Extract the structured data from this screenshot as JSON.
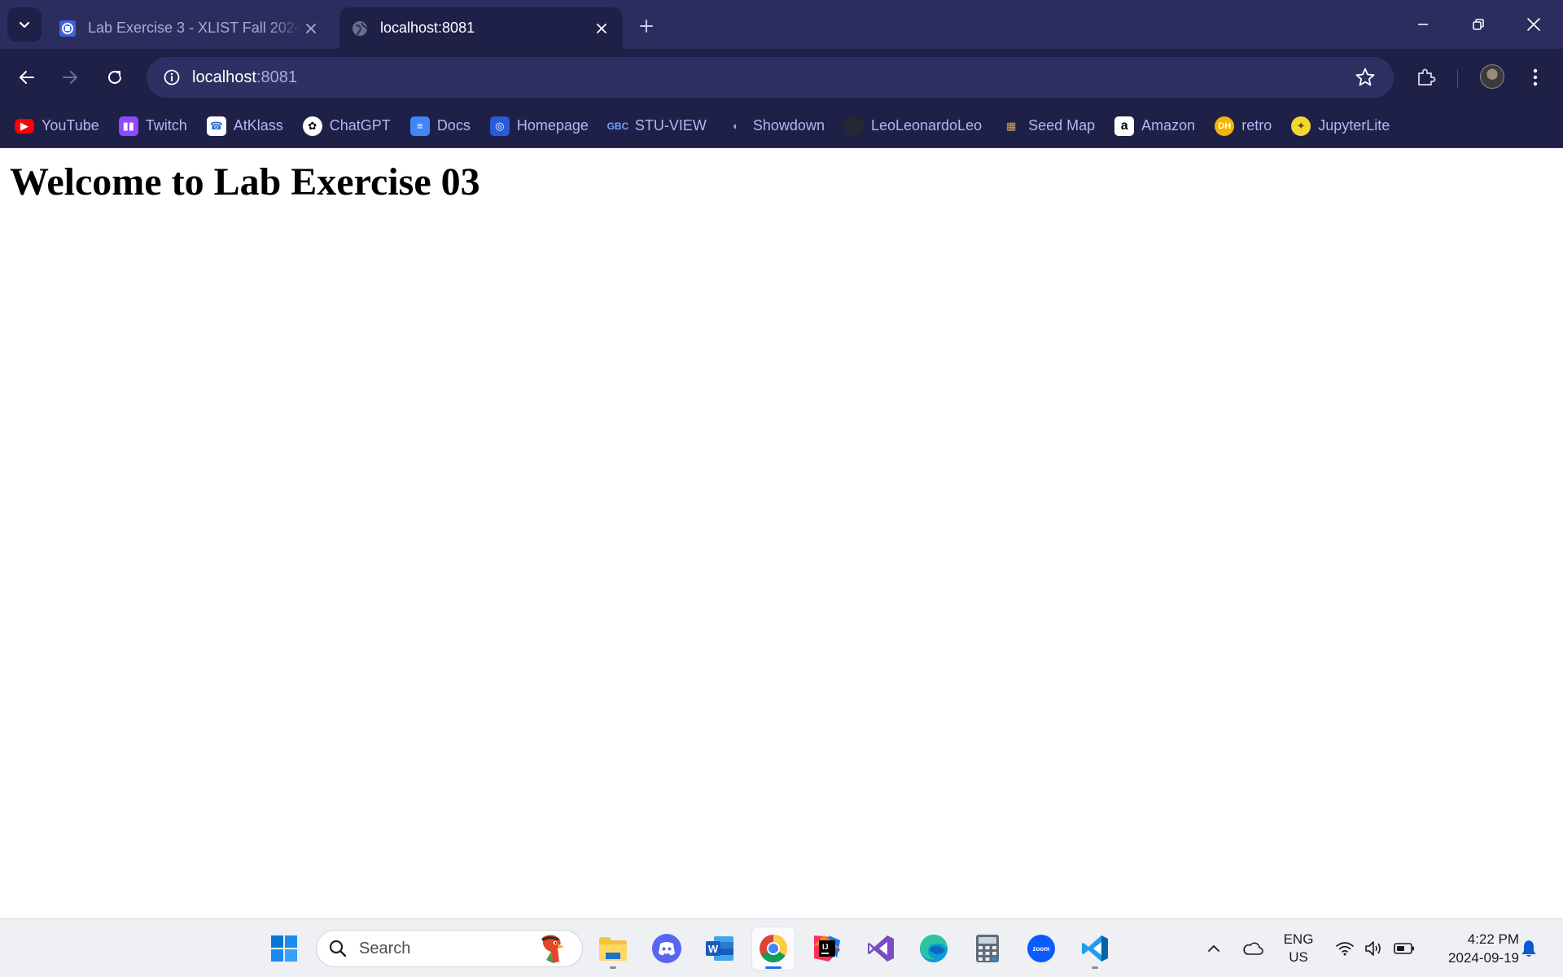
{
  "browser": {
    "tabs": [
      {
        "title": "Lab Exercise 3 - XLIST Fall 2024",
        "active": false,
        "favicon": "gbc-favicon-icon"
      },
      {
        "title": "localhost:8081",
        "active": true,
        "favicon": "globe-icon"
      }
    ],
    "omnibox": {
      "host": "localhost",
      "port": ":8081"
    },
    "bookmarks": [
      {
        "label": "YouTube",
        "icon": "youtube-icon",
        "color": "#ff0000"
      },
      {
        "label": "Twitch",
        "icon": "twitch-icon",
        "color": "#9146ff"
      },
      {
        "label": "AtKlass",
        "icon": "atklass-icon",
        "color": "#2f6fde"
      },
      {
        "label": "ChatGPT",
        "icon": "chatgpt-icon",
        "color": "#ffffff"
      },
      {
        "label": "Docs",
        "icon": "docs-icon",
        "color": "#4285f4"
      },
      {
        "label": "Homepage",
        "icon": "homepage-icon",
        "color": "#2a5bd7"
      },
      {
        "label": "STU-VIEW",
        "icon": "gbc-icon",
        "color": "#2a6fcf"
      },
      {
        "label": "Showdown",
        "icon": "showdown-icon",
        "color": "#7bb3f0"
      },
      {
        "label": "LeoLeonardoLeo",
        "icon": "github-icon",
        "color": "#24292f"
      },
      {
        "label": "Seed Map",
        "icon": "seedmap-icon",
        "color": "#b58b4c"
      },
      {
        "label": "Amazon",
        "icon": "amazon-icon",
        "color": "#ffffff"
      },
      {
        "label": "retro",
        "icon": "retro-icon",
        "color": "#f4b400"
      },
      {
        "label": "JupyterLite",
        "icon": "jupyterlite-icon",
        "color": "#f3d630"
      }
    ]
  },
  "page": {
    "heading": "Welcome to Lab Exercise 03"
  },
  "taskbar": {
    "search_label": "Search",
    "apps": [
      {
        "name": "file-explorer-icon",
        "running": true
      },
      {
        "name": "discord-icon",
        "running": false
      },
      {
        "name": "word-icon",
        "running": false
      },
      {
        "name": "chrome-icon",
        "running": true,
        "active": true
      },
      {
        "name": "intellij-icon",
        "running": false
      },
      {
        "name": "visual-studio-icon",
        "running": false
      },
      {
        "name": "edge-icon",
        "running": false
      },
      {
        "name": "calculator-icon",
        "running": false
      },
      {
        "name": "zoom-icon",
        "running": false
      },
      {
        "name": "vscode-icon",
        "running": true
      }
    ],
    "tray": {
      "lang_line1": "ENG",
      "lang_line2": "US",
      "time": "4:22 PM",
      "date": "2024-09-19"
    }
  }
}
